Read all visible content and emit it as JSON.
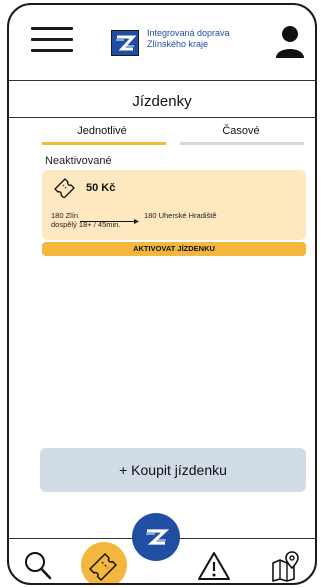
{
  "header": {
    "logo_line1": "Integrovaná doprava",
    "logo_line2": "Zlínského kraje"
  },
  "page": {
    "title": "Jízdenky"
  },
  "tabs": [
    {
      "label": "Jednotlivé",
      "active": true
    },
    {
      "label": "Časové",
      "active": false
    }
  ],
  "section": {
    "label": "Neaktivované"
  },
  "ticket": {
    "price": "50 Kč",
    "from": "180 Zlín",
    "to": "180 Uherské Hradiště",
    "detail": "dospělý 18+ / 45min.",
    "activate_label": "AKTIVOVAT JÍZDENKU"
  },
  "buy_button": {
    "label": "+ Koupit jízdenku"
  },
  "bottom_nav": {
    "items": [
      "search-icon",
      "ticket-icon",
      "warning-icon",
      "map-pin-icon"
    ]
  },
  "colors": {
    "accent": "#f3b73e",
    "brand": "#1f4ea3",
    "card_bg": "#fde8c0",
    "buy_bg": "#d2dce6"
  }
}
